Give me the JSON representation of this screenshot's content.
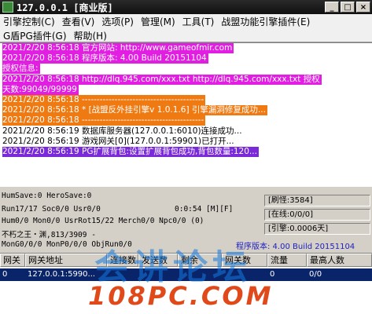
{
  "window": {
    "title": "127.0.0.1 [商业版]"
  },
  "menu": {
    "row1": [
      "引擎控制(C)",
      "查看(V)",
      "选项(P)",
      "管理(M)",
      "工具(T)",
      "战盟功能引擎插件(E)"
    ],
    "row2": [
      "G盾PG插件(G)",
      "帮助(H)"
    ]
  },
  "log": [
    {
      "text": "2021/2/20 8:56:18 官方网站: http://www.gameofmir.com",
      "style": "magenta"
    },
    {
      "text": "2021/2/20 8:56:18 程序版本: 4.00 Build 20151104",
      "style": "magenta"
    },
    {
      "text": "授权信息:",
      "style": "magenta"
    },
    {
      "text": "2021/2/20 8:56:18 http://dlq.945.com/xxx.txt http://dlq.945.com/xxx.txt 授权",
      "style": "magenta"
    },
    {
      "text": "天数:99049/99999",
      "style": "magenta"
    },
    {
      "text": "2021/2/20 8:56:18 -----------------------------------------",
      "style": "orange"
    },
    {
      "text": "2021/2/20 8:56:18 * [战盟反外挂引擎v 1.0.1.6] 引擎漏洞修复成功...",
      "style": "orange"
    },
    {
      "text": "2021/2/20 8:56:18 -----------------------------------------",
      "style": "orange"
    },
    {
      "text": "2021/2/20 8:56:19 数据库服务器(127.0.0.1:6010)连接成功...",
      "style": "plain"
    },
    {
      "text": "2021/2/20 8:56:19 游戏网关[0](127.0.0.1:59901)已打开...",
      "style": "plain"
    },
    {
      "text": "2021/2/20 8:56:19 PG扩展背包:设置扩展背包成功,背包数量:120...",
      "style": "purple"
    }
  ],
  "status": {
    "line1": "HumSave:0 HeroSave:0",
    "line2": "Run17/17 Soc0/0 Usr0/0",
    "line2_time": "0:0:54 [M][F]",
    "line3": "Hum0/0 Mon0/0 UsrRot15/22 Merch0/0 Npc0/0 (0)",
    "line4": "不朽之王・渊,813/3909 -",
    "line5": "MonG0/0/0 MonP0/0/0 ObjRun0/0",
    "refresh": "[刷怪:3584]",
    "online": "[在线:0/0/0]",
    "engine": "[引擎:0.0006天]",
    "build": "程序版本: 4.00 Build 20151104"
  },
  "table": {
    "headers": [
      "网关",
      "网关地址",
      "连接数",
      "发送数",
      "剩余",
      "网关数",
      "流量",
      "最高人数"
    ],
    "rows": [
      [
        "0",
        "127.0.0.1:5990...",
        "",
        "",
        "",
        "",
        "0",
        "0/0"
      ]
    ]
  },
  "watermark": {
    "top": "会讲论坛",
    "bottom": "108PC.COM"
  }
}
